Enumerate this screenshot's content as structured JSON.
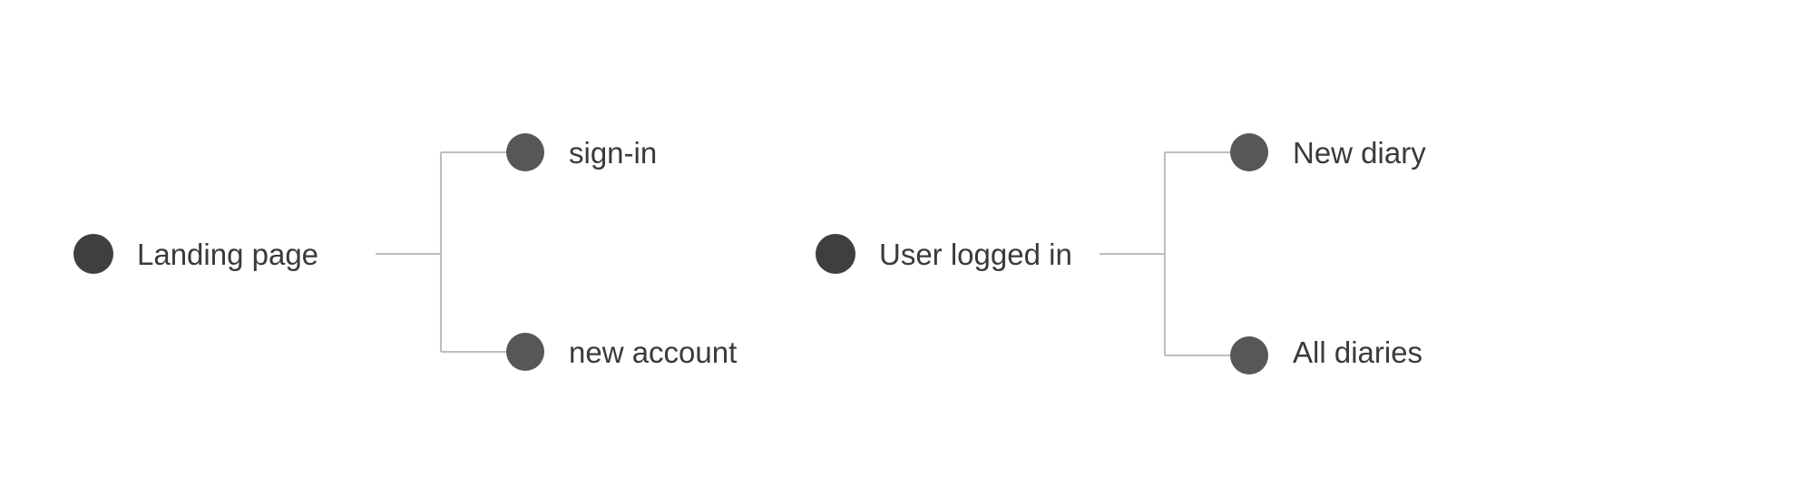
{
  "colors": {
    "root_dot": "#3f3f3f",
    "child_dot": "#575757",
    "connector": "#bdbdbd",
    "text": "#3a3a3a"
  },
  "trees": [
    {
      "root": {
        "label": "Landing page"
      },
      "children": [
        {
          "label": "sign-in"
        },
        {
          "label": "new account"
        }
      ]
    },
    {
      "root": {
        "label": "User logged in"
      },
      "children": [
        {
          "label": "New diary"
        },
        {
          "label": "All diaries"
        }
      ]
    }
  ]
}
